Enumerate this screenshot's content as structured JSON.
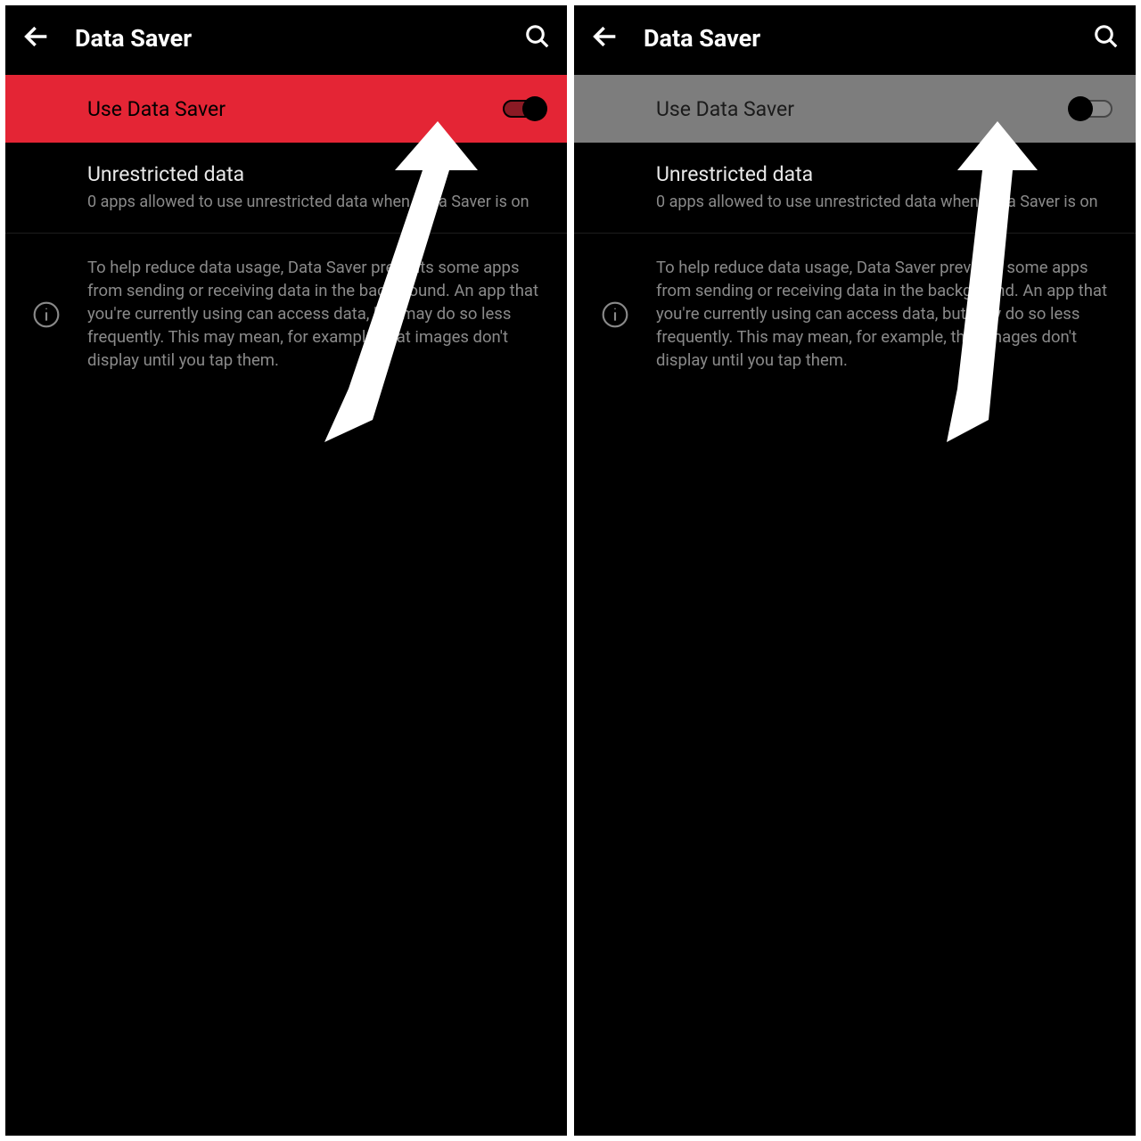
{
  "panes": [
    {
      "header": {
        "title": "Data Saver"
      },
      "toggle": {
        "label": "Use Data Saver",
        "state": "on"
      },
      "unrestricted": {
        "title": "Unrestricted data",
        "subtitle": "0 apps allowed to use unrestricted data when Data Saver is on"
      },
      "info": {
        "text": "To help reduce data usage, Data Saver prevents some apps from sending or receiving data in the background. An app that you're currently using can access data, but may do so less frequently. This may mean, for example, that images don't display until you tap them."
      }
    },
    {
      "header": {
        "title": "Data Saver"
      },
      "toggle": {
        "label": "Use Data Saver",
        "state": "off"
      },
      "unrestricted": {
        "title": "Unrestricted data",
        "subtitle": "0 apps allowed to use unrestricted data when Data Saver is on"
      },
      "info": {
        "text": "To help reduce data usage, Data Saver prevents some apps from sending or receiving data in the background. An app that you're currently using can access data, but may do so less frequently. This may mean, for example, that images don't display until you tap them."
      }
    }
  ]
}
